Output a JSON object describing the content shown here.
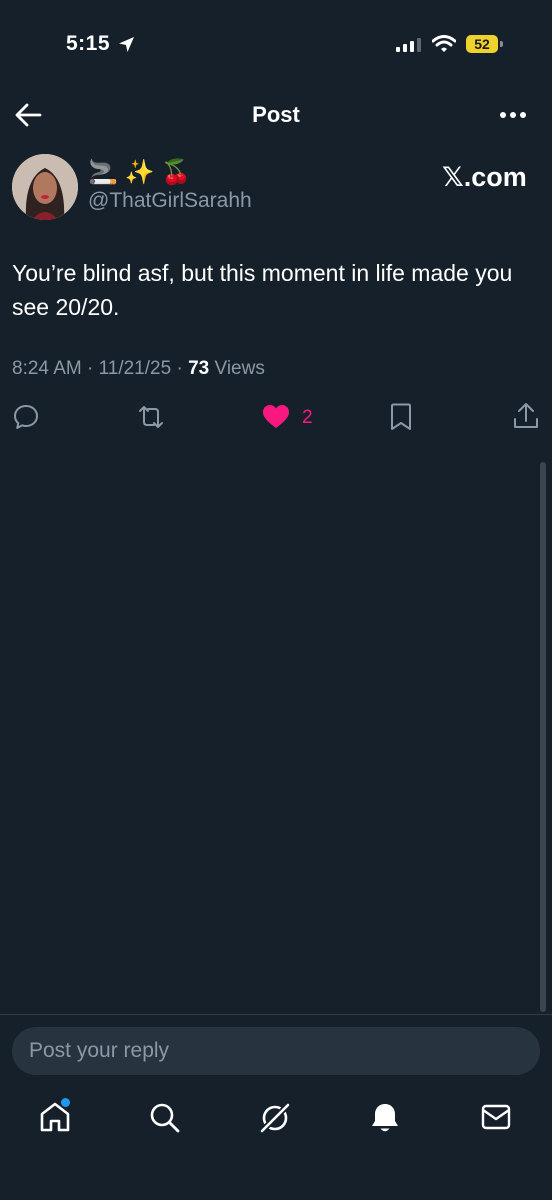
{
  "status_bar": {
    "time": "5:15",
    "battery": "52",
    "battery_color": "#f0d22c"
  },
  "header": {
    "title": "Post",
    "back_icon": "arrow-left-icon",
    "more_icon": "more-horizontal-icon"
  },
  "author": {
    "display_name": "🚬 ✨ 🍒",
    "handle": "@ThatGirlSarahh",
    "avatar_icon": "avatar"
  },
  "watermark": "𝕏.com",
  "post": {
    "text": "You’re blind asf, but this moment in life made you see 20/20.",
    "time": "8:24 AM",
    "separator": "·",
    "date": "11/21/25",
    "views_count": "73",
    "views_label": "Views"
  },
  "actions": {
    "like_count": "2",
    "liked": true,
    "like_color": "#f91880",
    "icons": [
      "reply-icon",
      "retweet-icon",
      "heart-icon",
      "bookmark-icon",
      "share-icon"
    ]
  },
  "reply": {
    "placeholder": "Post your reply"
  },
  "bottom_nav": {
    "items": [
      "home-icon",
      "search-icon",
      "grok-icon",
      "notifications-icon",
      "messages-icon"
    ],
    "accent": "#1d9bf0"
  },
  "theme": {
    "background": "#15202b",
    "muted_text": "#8b98a5"
  }
}
